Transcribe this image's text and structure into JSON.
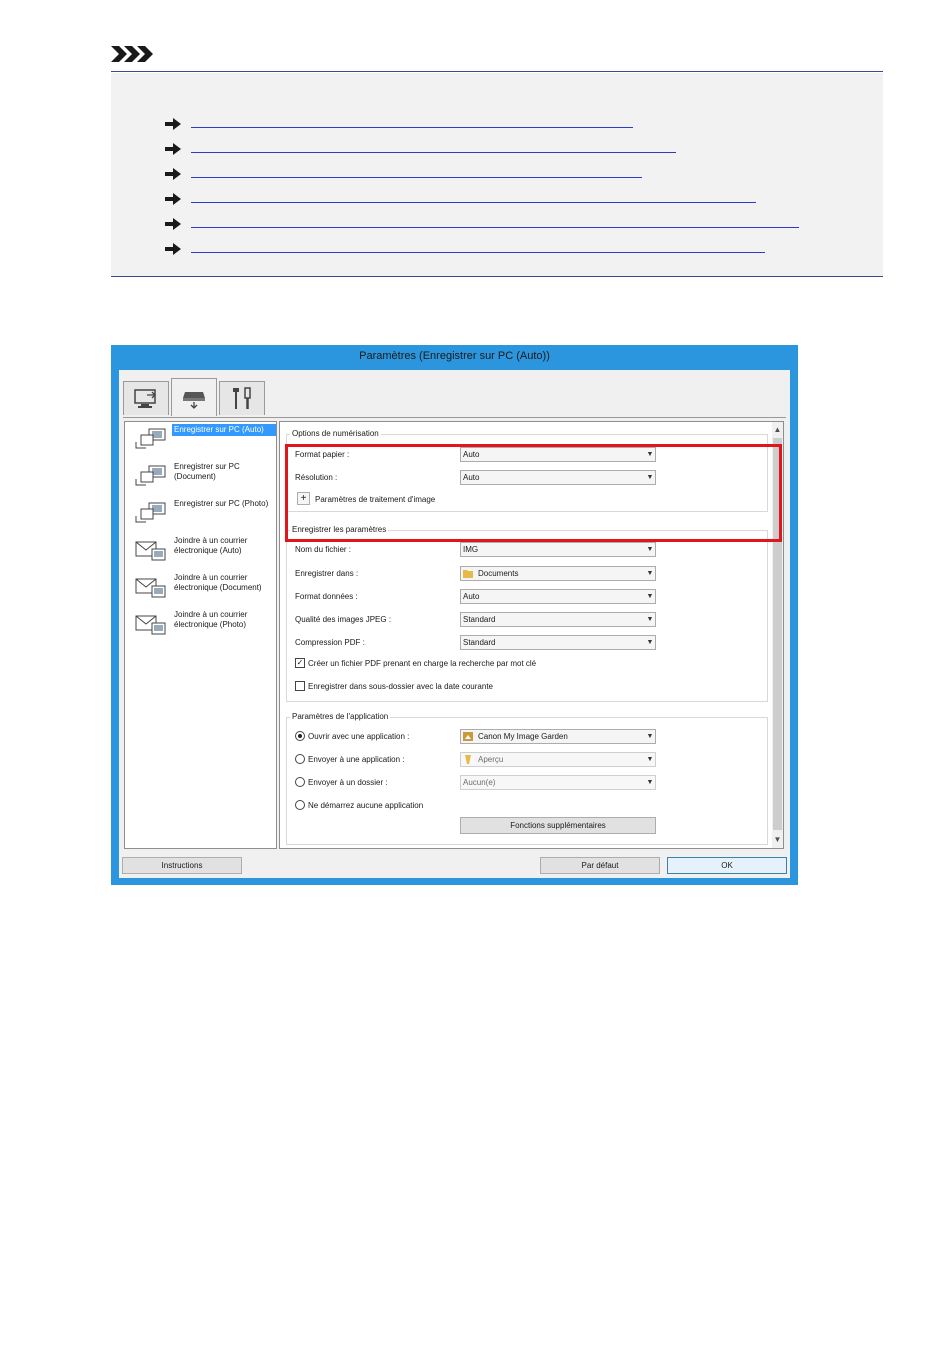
{
  "note": {
    "icon": "note-chevrons-icon",
    "links": [
      {
        "arrow": "arrow-right-icon"
      },
      {
        "arrow": "arrow-right-icon"
      },
      {
        "arrow": "arrow-right-icon"
      },
      {
        "arrow": "arrow-right-icon"
      },
      {
        "arrow": "arrow-right-icon"
      },
      {
        "arrow": "arrow-right-icon"
      }
    ]
  },
  "dialog": {
    "title": "Paramètres (Enregistrer sur PC (Auto))",
    "tabs": [
      {
        "icon": "scan-from-computer-icon"
      },
      {
        "icon": "scanner-panel-icon"
      },
      {
        "icon": "tools-icon"
      }
    ],
    "list_items": [
      {
        "label": "Enregistrer sur PC (Auto)",
        "icon": "save-to-pc-icon",
        "selected": true
      },
      {
        "label": "Enregistrer sur PC (Document)",
        "icon": "save-to-pc-icon"
      },
      {
        "label": "Enregistrer sur PC (Photo)",
        "icon": "save-to-pc-icon"
      },
      {
        "label": "Joindre à un courrier électronique (Auto)",
        "icon": "email-attach-icon"
      },
      {
        "label": "Joindre à un courrier électronique (Document)",
        "icon": "email-attach-icon"
      },
      {
        "label": "Joindre à un courrier électronique (Photo)",
        "icon": "email-attach-icon"
      }
    ],
    "scan_options": {
      "title": "Options de numérisation",
      "paper_size_label": "Format papier :",
      "paper_size_value": "Auto",
      "resolution_label": "Résolution :",
      "resolution_value": "Auto",
      "image_processing_label": "Paramètres de traitement d'image"
    },
    "save_settings": {
      "title": "Enregistrer les paramètres",
      "filename_label": "Nom du fichier :",
      "filename_value": "IMG",
      "save_in_label": "Enregistrer dans :",
      "save_in_value": "Documents",
      "data_format_label": "Format données :",
      "data_format_value": "Auto",
      "jpeg_quality_label": "Qualité des images JPEG :",
      "jpeg_quality_value": "Standard",
      "pdf_compression_label": "Compression PDF :",
      "pdf_compression_value": "Standard",
      "searchable_pdf_label": "Créer un fichier PDF prenant en charge la recherche par mot clé",
      "searchable_pdf_checked": true,
      "subfolder_label": "Enregistrer dans sous-dossier avec la date courante",
      "subfolder_checked": false
    },
    "app_settings": {
      "title": "Paramètres de l'application",
      "open_app_label": "Ouvrir avec une application :",
      "open_app_value": "Canon My Image Garden",
      "send_app_label": "Envoyer à une application :",
      "send_app_value": "Aperçu",
      "send_folder_label": "Envoyer à un dossier :",
      "send_folder_value": "Aucun(e)",
      "no_app_label": "Ne démarrez aucune application",
      "selected_option": "open_app",
      "more_functions_label": "Fonctions supplémentaires"
    },
    "buttons": {
      "instructions": "Instructions",
      "defaults": "Par défaut",
      "ok": "OK"
    },
    "colors": {
      "frame": "#2b95de",
      "highlight": "#e0161c",
      "selection": "#3399ff"
    }
  }
}
